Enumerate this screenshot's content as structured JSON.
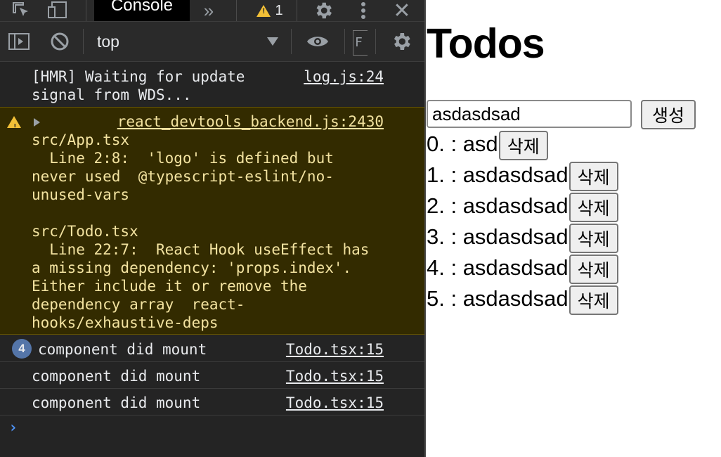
{
  "devtools": {
    "tabs": {
      "active_label": "Console",
      "warning_count": "1"
    },
    "toolbar": {
      "context": "top",
      "filter_partial": "F"
    },
    "logs": [
      {
        "message": "[HMR] Waiting for update\nsignal from WDS...",
        "source": "log.js:24"
      },
      {
        "level": "warning",
        "source": "react_devtools_backend.js:2430",
        "message": "src/App.tsx\n  Line 2:8:  'logo' is defined but\nnever used  @typescript-eslint/no-\nunused-vars\n\nsrc/Todo.tsx\n  Line 22:7:  React Hook useEffect has\na missing dependency: 'props.index'.\nEither include it or remove the\ndependency array  react-\nhooks/exhaustive-deps"
      },
      {
        "message": "component did mount",
        "source": "Todo.tsx:15",
        "repeat": "4"
      },
      {
        "message": "component did mount",
        "source": "Todo.tsx:15"
      },
      {
        "message": "component did mount",
        "source": "Todo.tsx:15"
      }
    ],
    "prompt": "›"
  },
  "app": {
    "title": "Todos",
    "input_value": "asdasdsad",
    "create_label": "생성",
    "delete_label": "삭제",
    "todos": [
      "0. : asd",
      "1. : asdasdsad",
      "2. : asdasdsad",
      "3. : asdasdsad",
      "4. : asdasdsad",
      "5. : asdasdsad"
    ]
  },
  "colors": {
    "warning": "#f2c037",
    "badge": "#5475a8",
    "prompt": "#4d90f0"
  }
}
